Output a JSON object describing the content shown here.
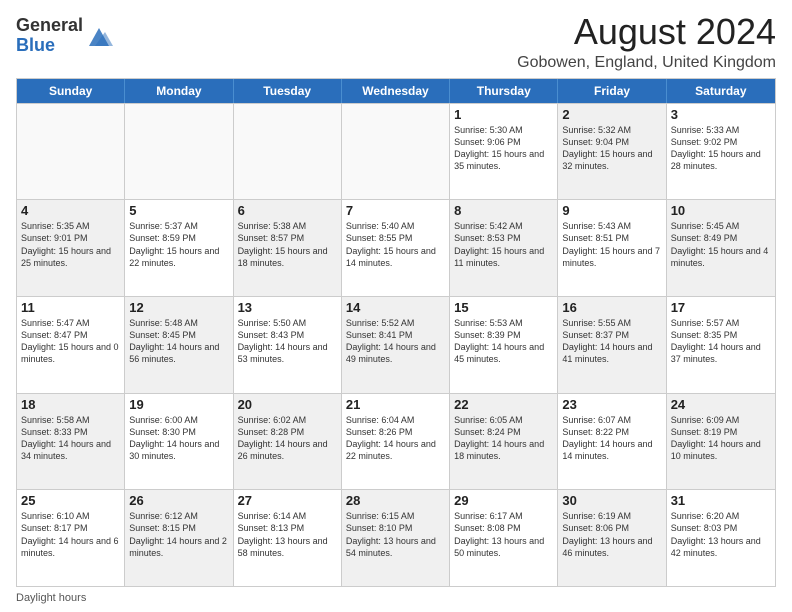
{
  "header": {
    "logo_general": "General",
    "logo_blue": "Blue",
    "main_title": "August 2024",
    "subtitle": "Gobowen, England, United Kingdom"
  },
  "weekdays": [
    "Sunday",
    "Monday",
    "Tuesday",
    "Wednesday",
    "Thursday",
    "Friday",
    "Saturday"
  ],
  "footer": {
    "note": "Daylight hours"
  },
  "rows": [
    [
      {
        "day": "",
        "sunrise": "",
        "sunset": "",
        "daylight": "",
        "shaded": false,
        "empty": true
      },
      {
        "day": "",
        "sunrise": "",
        "sunset": "",
        "daylight": "",
        "shaded": false,
        "empty": true
      },
      {
        "day": "",
        "sunrise": "",
        "sunset": "",
        "daylight": "",
        "shaded": false,
        "empty": true
      },
      {
        "day": "",
        "sunrise": "",
        "sunset": "",
        "daylight": "",
        "shaded": false,
        "empty": true
      },
      {
        "day": "1",
        "sunrise": "Sunrise: 5:30 AM",
        "sunset": "Sunset: 9:06 PM",
        "daylight": "Daylight: 15 hours and 35 minutes.",
        "shaded": false,
        "empty": false
      },
      {
        "day": "2",
        "sunrise": "Sunrise: 5:32 AM",
        "sunset": "Sunset: 9:04 PM",
        "daylight": "Daylight: 15 hours and 32 minutes.",
        "shaded": true,
        "empty": false
      },
      {
        "day": "3",
        "sunrise": "Sunrise: 5:33 AM",
        "sunset": "Sunset: 9:02 PM",
        "daylight": "Daylight: 15 hours and 28 minutes.",
        "shaded": false,
        "empty": false
      }
    ],
    [
      {
        "day": "4",
        "sunrise": "Sunrise: 5:35 AM",
        "sunset": "Sunset: 9:01 PM",
        "daylight": "Daylight: 15 hours and 25 minutes.",
        "shaded": true,
        "empty": false
      },
      {
        "day": "5",
        "sunrise": "Sunrise: 5:37 AM",
        "sunset": "Sunset: 8:59 PM",
        "daylight": "Daylight: 15 hours and 22 minutes.",
        "shaded": false,
        "empty": false
      },
      {
        "day": "6",
        "sunrise": "Sunrise: 5:38 AM",
        "sunset": "Sunset: 8:57 PM",
        "daylight": "Daylight: 15 hours and 18 minutes.",
        "shaded": true,
        "empty": false
      },
      {
        "day": "7",
        "sunrise": "Sunrise: 5:40 AM",
        "sunset": "Sunset: 8:55 PM",
        "daylight": "Daylight: 15 hours and 14 minutes.",
        "shaded": false,
        "empty": false
      },
      {
        "day": "8",
        "sunrise": "Sunrise: 5:42 AM",
        "sunset": "Sunset: 8:53 PM",
        "daylight": "Daylight: 15 hours and 11 minutes.",
        "shaded": true,
        "empty": false
      },
      {
        "day": "9",
        "sunrise": "Sunrise: 5:43 AM",
        "sunset": "Sunset: 8:51 PM",
        "daylight": "Daylight: 15 hours and 7 minutes.",
        "shaded": false,
        "empty": false
      },
      {
        "day": "10",
        "sunrise": "Sunrise: 5:45 AM",
        "sunset": "Sunset: 8:49 PM",
        "daylight": "Daylight: 15 hours and 4 minutes.",
        "shaded": true,
        "empty": false
      }
    ],
    [
      {
        "day": "11",
        "sunrise": "Sunrise: 5:47 AM",
        "sunset": "Sunset: 8:47 PM",
        "daylight": "Daylight: 15 hours and 0 minutes.",
        "shaded": false,
        "empty": false
      },
      {
        "day": "12",
        "sunrise": "Sunrise: 5:48 AM",
        "sunset": "Sunset: 8:45 PM",
        "daylight": "Daylight: 14 hours and 56 minutes.",
        "shaded": true,
        "empty": false
      },
      {
        "day": "13",
        "sunrise": "Sunrise: 5:50 AM",
        "sunset": "Sunset: 8:43 PM",
        "daylight": "Daylight: 14 hours and 53 minutes.",
        "shaded": false,
        "empty": false
      },
      {
        "day": "14",
        "sunrise": "Sunrise: 5:52 AM",
        "sunset": "Sunset: 8:41 PM",
        "daylight": "Daylight: 14 hours and 49 minutes.",
        "shaded": true,
        "empty": false
      },
      {
        "day": "15",
        "sunrise": "Sunrise: 5:53 AM",
        "sunset": "Sunset: 8:39 PM",
        "daylight": "Daylight: 14 hours and 45 minutes.",
        "shaded": false,
        "empty": false
      },
      {
        "day": "16",
        "sunrise": "Sunrise: 5:55 AM",
        "sunset": "Sunset: 8:37 PM",
        "daylight": "Daylight: 14 hours and 41 minutes.",
        "shaded": true,
        "empty": false
      },
      {
        "day": "17",
        "sunrise": "Sunrise: 5:57 AM",
        "sunset": "Sunset: 8:35 PM",
        "daylight": "Daylight: 14 hours and 37 minutes.",
        "shaded": false,
        "empty": false
      }
    ],
    [
      {
        "day": "18",
        "sunrise": "Sunrise: 5:58 AM",
        "sunset": "Sunset: 8:33 PM",
        "daylight": "Daylight: 14 hours and 34 minutes.",
        "shaded": true,
        "empty": false
      },
      {
        "day": "19",
        "sunrise": "Sunrise: 6:00 AM",
        "sunset": "Sunset: 8:30 PM",
        "daylight": "Daylight: 14 hours and 30 minutes.",
        "shaded": false,
        "empty": false
      },
      {
        "day": "20",
        "sunrise": "Sunrise: 6:02 AM",
        "sunset": "Sunset: 8:28 PM",
        "daylight": "Daylight: 14 hours and 26 minutes.",
        "shaded": true,
        "empty": false
      },
      {
        "day": "21",
        "sunrise": "Sunrise: 6:04 AM",
        "sunset": "Sunset: 8:26 PM",
        "daylight": "Daylight: 14 hours and 22 minutes.",
        "shaded": false,
        "empty": false
      },
      {
        "day": "22",
        "sunrise": "Sunrise: 6:05 AM",
        "sunset": "Sunset: 8:24 PM",
        "daylight": "Daylight: 14 hours and 18 minutes.",
        "shaded": true,
        "empty": false
      },
      {
        "day": "23",
        "sunrise": "Sunrise: 6:07 AM",
        "sunset": "Sunset: 8:22 PM",
        "daylight": "Daylight: 14 hours and 14 minutes.",
        "shaded": false,
        "empty": false
      },
      {
        "day": "24",
        "sunrise": "Sunrise: 6:09 AM",
        "sunset": "Sunset: 8:19 PM",
        "daylight": "Daylight: 14 hours and 10 minutes.",
        "shaded": true,
        "empty": false
      }
    ],
    [
      {
        "day": "25",
        "sunrise": "Sunrise: 6:10 AM",
        "sunset": "Sunset: 8:17 PM",
        "daylight": "Daylight: 14 hours and 6 minutes.",
        "shaded": false,
        "empty": false
      },
      {
        "day": "26",
        "sunrise": "Sunrise: 6:12 AM",
        "sunset": "Sunset: 8:15 PM",
        "daylight": "Daylight: 14 hours and 2 minutes.",
        "shaded": true,
        "empty": false
      },
      {
        "day": "27",
        "sunrise": "Sunrise: 6:14 AM",
        "sunset": "Sunset: 8:13 PM",
        "daylight": "Daylight: 13 hours and 58 minutes.",
        "shaded": false,
        "empty": false
      },
      {
        "day": "28",
        "sunrise": "Sunrise: 6:15 AM",
        "sunset": "Sunset: 8:10 PM",
        "daylight": "Daylight: 13 hours and 54 minutes.",
        "shaded": true,
        "empty": false
      },
      {
        "day": "29",
        "sunrise": "Sunrise: 6:17 AM",
        "sunset": "Sunset: 8:08 PM",
        "daylight": "Daylight: 13 hours and 50 minutes.",
        "shaded": false,
        "empty": false
      },
      {
        "day": "30",
        "sunrise": "Sunrise: 6:19 AM",
        "sunset": "Sunset: 8:06 PM",
        "daylight": "Daylight: 13 hours and 46 minutes.",
        "shaded": true,
        "empty": false
      },
      {
        "day": "31",
        "sunrise": "Sunrise: 6:20 AM",
        "sunset": "Sunset: 8:03 PM",
        "daylight": "Daylight: 13 hours and 42 minutes.",
        "shaded": false,
        "empty": false
      }
    ]
  ]
}
